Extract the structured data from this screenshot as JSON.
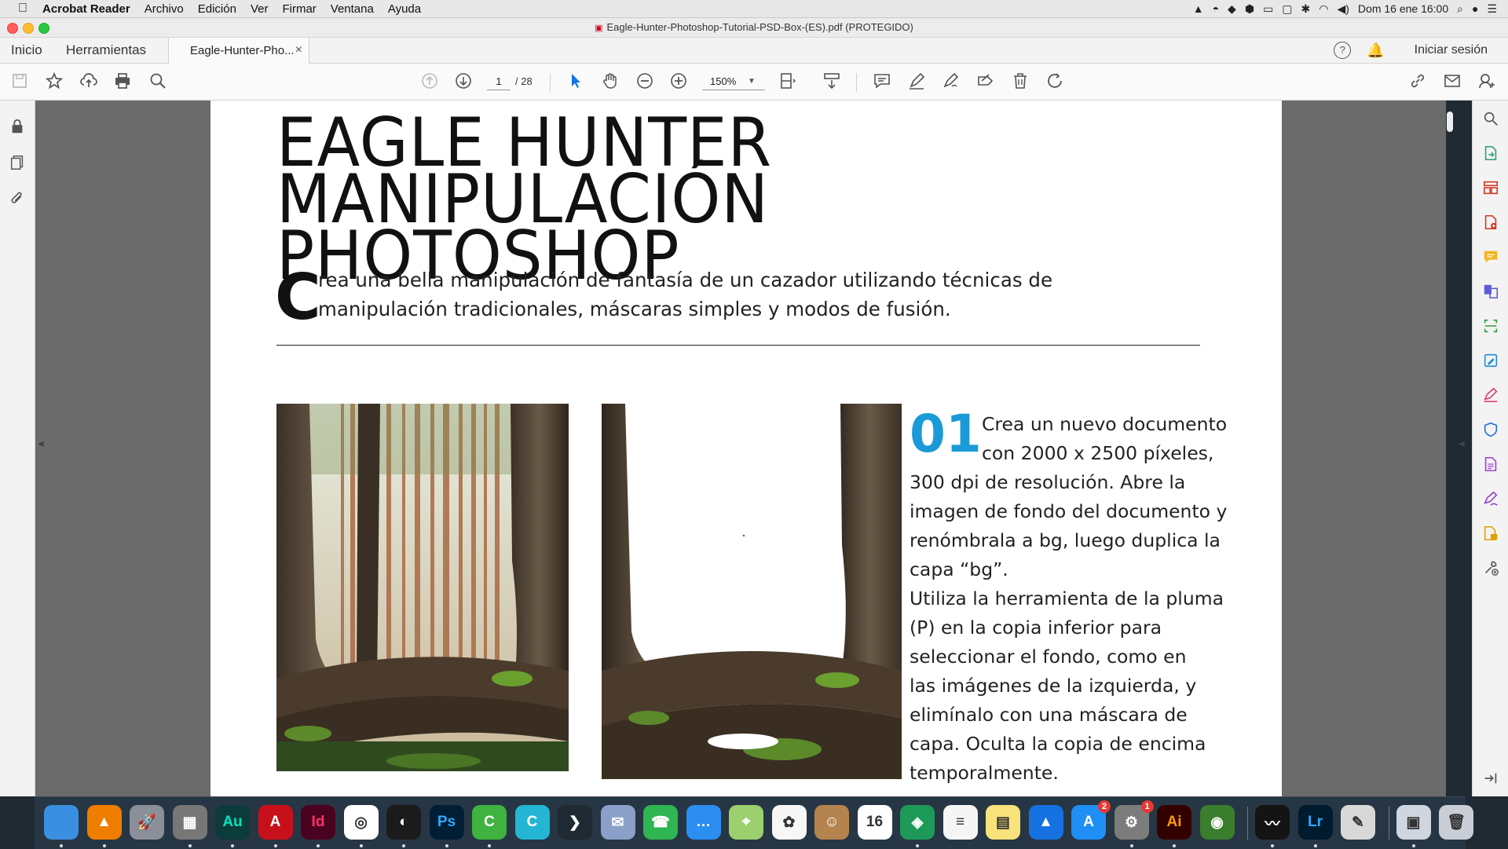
{
  "menubar": {
    "app": "Acrobat Reader",
    "items": [
      "Archivo",
      "Edición",
      "Ver",
      "Firmar",
      "Ventana",
      "Ayuda"
    ],
    "clock": "Dom 16 ene  16:00"
  },
  "window": {
    "title": "Eagle-Hunter-Photoshop-Tutorial-PSD-Box-(ES).pdf (PROTEGIDO)"
  },
  "tabs": {
    "home": "Inicio",
    "tools": "Herramientas",
    "document": "Eagle-Hunter-Pho...",
    "close": "×",
    "signin": "Iniciar sesión"
  },
  "toolbar": {
    "page_current": "1",
    "page_total": "/ 28",
    "zoom": "150%"
  },
  "document": {
    "title_line1": "EAGLE HUNTER",
    "title_line2": "MANIPULACIÓN PHOTOSHOP",
    "dropcap": "C",
    "intro": "rea una bella manipulación de fantasía de un cazador utilizando técnicas de manipulación tradicionales, máscaras simples y modos de fusión.",
    "step_number": "01",
    "step_lines": [
      "Crea un nuevo documento",
      "con 2000 x 2500 píxeles,",
      "300 dpi de resolución. Abre la",
      "imagen de fondo del documento y",
      "renómbrala a bg, luego duplica la",
      "capa “bg”.",
      "Utiliza la herramienta de la pluma",
      "(P) en la copia inferior para",
      "seleccionar el fondo, como en",
      "las imágenes de la izquierda, y",
      "elimínalo con una máscara de",
      "capa. Oculta la copia de encima",
      "temporalmente."
    ]
  },
  "dock": {
    "apps": [
      {
        "label": "",
        "name": "finder",
        "color": "#3b8fe0"
      },
      {
        "label": "▲",
        "name": "vlc",
        "color": "#ef7d00"
      },
      {
        "label": "🚀",
        "name": "launchpad",
        "color": "#8a8f99"
      },
      {
        "label": "▦",
        "name": "calculator",
        "color": "#777"
      },
      {
        "label": "Au",
        "name": "audition",
        "color": "#0b3b3a"
      },
      {
        "label": "A",
        "name": "acrobat",
        "color": "#c8101a"
      },
      {
        "label": "Id",
        "name": "indesign",
        "color": "#49021f"
      },
      {
        "label": "◎",
        "name": "chrome",
        "color": "#ffffff"
      },
      {
        "label": "◐",
        "name": "gpu-monitor",
        "color": "#1b1b1b"
      },
      {
        "label": "Ps",
        "name": "photoshop",
        "color": "#001e36"
      },
      {
        "label": "C",
        "name": "cursor-app",
        "color": "#3fb23f"
      },
      {
        "label": "C",
        "name": "canva",
        "color": "#23b5d3"
      },
      {
        "label": "❯",
        "name": "shortcut-app",
        "color": "#1f2a33"
      },
      {
        "label": "✉",
        "name": "mail-stamp",
        "color": "#8aa0c8"
      },
      {
        "label": "☎",
        "name": "facetime",
        "color": "#2fb552"
      },
      {
        "label": "…",
        "name": "messages",
        "color": "#2b8ef0"
      },
      {
        "label": "⌖",
        "name": "maps",
        "color": "#9ccf6d"
      },
      {
        "label": "✿",
        "name": "photos",
        "color": "#f7f7f7"
      },
      {
        "label": "☺",
        "name": "contacts",
        "color": "#b5834e"
      },
      {
        "label": "16",
        "name": "calendar",
        "color": "#ffffff"
      },
      {
        "label": "◈",
        "name": "green-app",
        "color": "#1d9a58"
      },
      {
        "label": "≡",
        "name": "reminders",
        "color": "#f5f5f5"
      },
      {
        "label": "▤",
        "name": "notes",
        "color": "#f8e27a"
      },
      {
        "label": "▲",
        "name": "send-app",
        "color": "#1571e0"
      },
      {
        "label": "A",
        "name": "app-store",
        "color": "#1f8ff5"
      },
      {
        "label": "⚙",
        "name": "system-preferences",
        "color": "#7c7c7c"
      },
      {
        "label": "Ai",
        "name": "illustrator",
        "color": "#330000"
      },
      {
        "label": "◉",
        "name": "rob-app",
        "color": "#3a7d2c"
      },
      {
        "label": "〰",
        "name": "activity-monitor",
        "color": "#141414"
      },
      {
        "label": "Lr",
        "name": "lightroom",
        "color": "#001a2e"
      },
      {
        "label": "✎",
        "name": "script-app",
        "color": "#d8d8d8"
      },
      {
        "label": "▣",
        "name": "preview",
        "color": "#cfd6df"
      },
      {
        "label": "🗑",
        "name": "trash",
        "color": "#c9ced6"
      }
    ],
    "badges": {
      "app_store": "2",
      "system_preferences": "1"
    }
  }
}
